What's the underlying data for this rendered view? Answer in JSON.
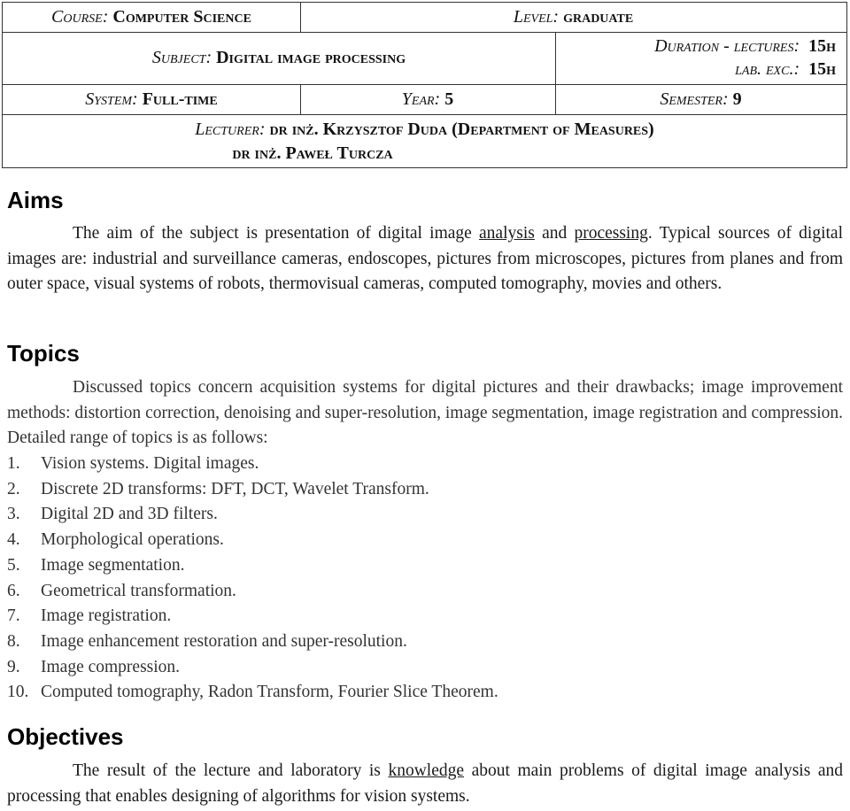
{
  "header": {
    "course": {
      "label": "Course:",
      "value": "Computer Science"
    },
    "level": {
      "label": "Level:",
      "value": "graduate"
    },
    "subject": {
      "label": "Subject:",
      "value": "Digital image processing"
    },
    "duration": {
      "lectures_label": "Duration - lectures:",
      "lectures_value": "15h",
      "lab_label": "lab. exc.:",
      "lab_value": "15h"
    },
    "system": {
      "label": "System:",
      "value": "Full-time"
    },
    "year": {
      "label": "Year:",
      "value": "5"
    },
    "semester": {
      "label": "Semester:",
      "value": "9"
    },
    "lecturer": {
      "label": "Lecturer:",
      "line1": "dr inż. Krzysztof Duda (Department of Measures)",
      "line2": "dr inż. Paweł Turcza"
    }
  },
  "aims": {
    "heading": "Aims",
    "text_before": "The aim of the subject is presentation of digital image ",
    "underline1": "analysis",
    "text_mid": " and ",
    "underline2": "processing",
    "text_after": ". Typical sources of digital images are: industrial and surveillance cameras, endoscopes, pictures from microscopes, pictures from planes and from outer space, visual systems of robots, thermovisual cameras, computed tomography, movies and others."
  },
  "topics": {
    "heading": "Topics",
    "intro": "Discussed topics concern acquisition systems for digital pictures and their drawbacks; image improvement methods: distortion correction, denoising and super-resolution, image segmentation, image registration and compression. Detailed range of topics is as follows:",
    "items": [
      {
        "num": "1.",
        "text": "Vision systems. Digital images."
      },
      {
        "num": "2.",
        "text": "Discrete 2D transforms: DFT, DCT, Wavelet Transform."
      },
      {
        "num": "3.",
        "text": "Digital 2D and 3D filters."
      },
      {
        "num": "4.",
        "text": "Morphological operations."
      },
      {
        "num": "5.",
        "text": "Image segmentation."
      },
      {
        "num": "6.",
        "text": "Geometrical transformation."
      },
      {
        "num": "7.",
        "text": "Image registration."
      },
      {
        "num": "8.",
        "text": "Image enhancement restoration and super-resolution."
      },
      {
        "num": "9.",
        "text": "Image compression."
      },
      {
        "num": "10.",
        "text": "Computed tomography, Radon Transform, Fourier Slice Theorem."
      }
    ]
  },
  "objectives": {
    "heading": "Objectives",
    "text_before": "The result of the lecture and laboratory is ",
    "underline": "knowledge",
    "text_after": " about main problems of digital image analysis and processing that enables designing of algorithms for vision systems."
  }
}
